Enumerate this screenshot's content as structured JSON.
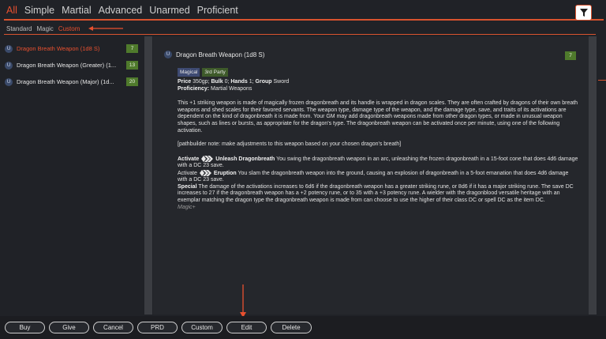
{
  "category_tabs": [
    "All",
    "Simple",
    "Martial",
    "Advanced",
    "Unarmed",
    "Proficient"
  ],
  "active_category": "All",
  "sub_tabs": [
    "Standard",
    "Magic",
    "Custom"
  ],
  "active_sub_tab": "Custom",
  "items": [
    {
      "badge": "U",
      "label": "Dragon Breath Weapon (1d8 S)",
      "level": "7"
    },
    {
      "badge": "U",
      "label": "Dragon Breath Weapon (Greater) (1...",
      "level": "13"
    },
    {
      "badge": "U",
      "label": "Dragon Breath Weapon (Major) (1d...",
      "level": "20"
    }
  ],
  "detail": {
    "badge": "U",
    "title": "Dragon Breath Weapon (1d8 S)",
    "level": "7",
    "traits": [
      "Magical",
      "3rd Party"
    ],
    "price_label": "Price",
    "price": "350gp;",
    "bulk_label": "Bulk",
    "bulk": "0;",
    "hands_label": "Hands",
    "hands": "1;",
    "group_label": "Group",
    "group": "Sword",
    "proficiency_label": "Proficiency:",
    "proficiency": "Martial Weapons",
    "description": "This +1 striking weapon is made of magically frozen dragonbreath and its handle is wrapped in dragon scales. They are often crafted by dragons of their own breath weapons and shed scales for their favored servants. The weapon type, damage type of the weapon, and the damage type, save, and traits of its activations are dependent on the kind of dragonbreath it is made from. Your GM may add dragonbreath weapons made from other dragon types, or made in unusual weapon shapes, such as lines or bursts, as appropriate for the dragon's type. The dragonbreath weapon can be activated once per minute, using one of the following activation.",
    "note": "[pathbuilder note: make adjustments to this weapon based on your chosen dragon's breath]",
    "activate_label": "Activate",
    "act1_name": "Unleash Dragonbreath",
    "act1_text": "You swing the dragonbreath weapon in an arc, unleashing the frozen dragonbreath in a 15-foot cone that does 4d6 damage with a DC 23 save.",
    "act2_name": "Eruption",
    "act2_text": "You slam the dragonbreath weapon into the ground, causing an explosion of dragonbreath in a 5-foot emanation that does 4d6 damage with a DC 23 save.",
    "special_label": "Special",
    "special_text": "The damage of the activations increases to 6d6 if the dragonbreath weapon has a greater striking rune, or 8d6 if it has a major striking rune. The save DC increases to 27 if the dragonbreath weapon has a +2 potency rune, or to 35 with a +3 potency rune. A wielder with the dragonblood versatile heritage with an exemplar matching the dragon type the dragonbreath weapon is made from can choose to use the higher of their class DC or spell DC as the item DC.",
    "source": "Magic+"
  },
  "buttons": [
    "Buy",
    "Give",
    "Cancel",
    "PRD",
    "Custom",
    "Edit",
    "Delete"
  ],
  "colors": {
    "accent": "#e8502f",
    "background": "#202227",
    "level_badge": "#4f7a2c",
    "magical_trait": "#3e4a72"
  },
  "icons": {
    "filter": "filter-icon",
    "action": "two-action-icon"
  }
}
